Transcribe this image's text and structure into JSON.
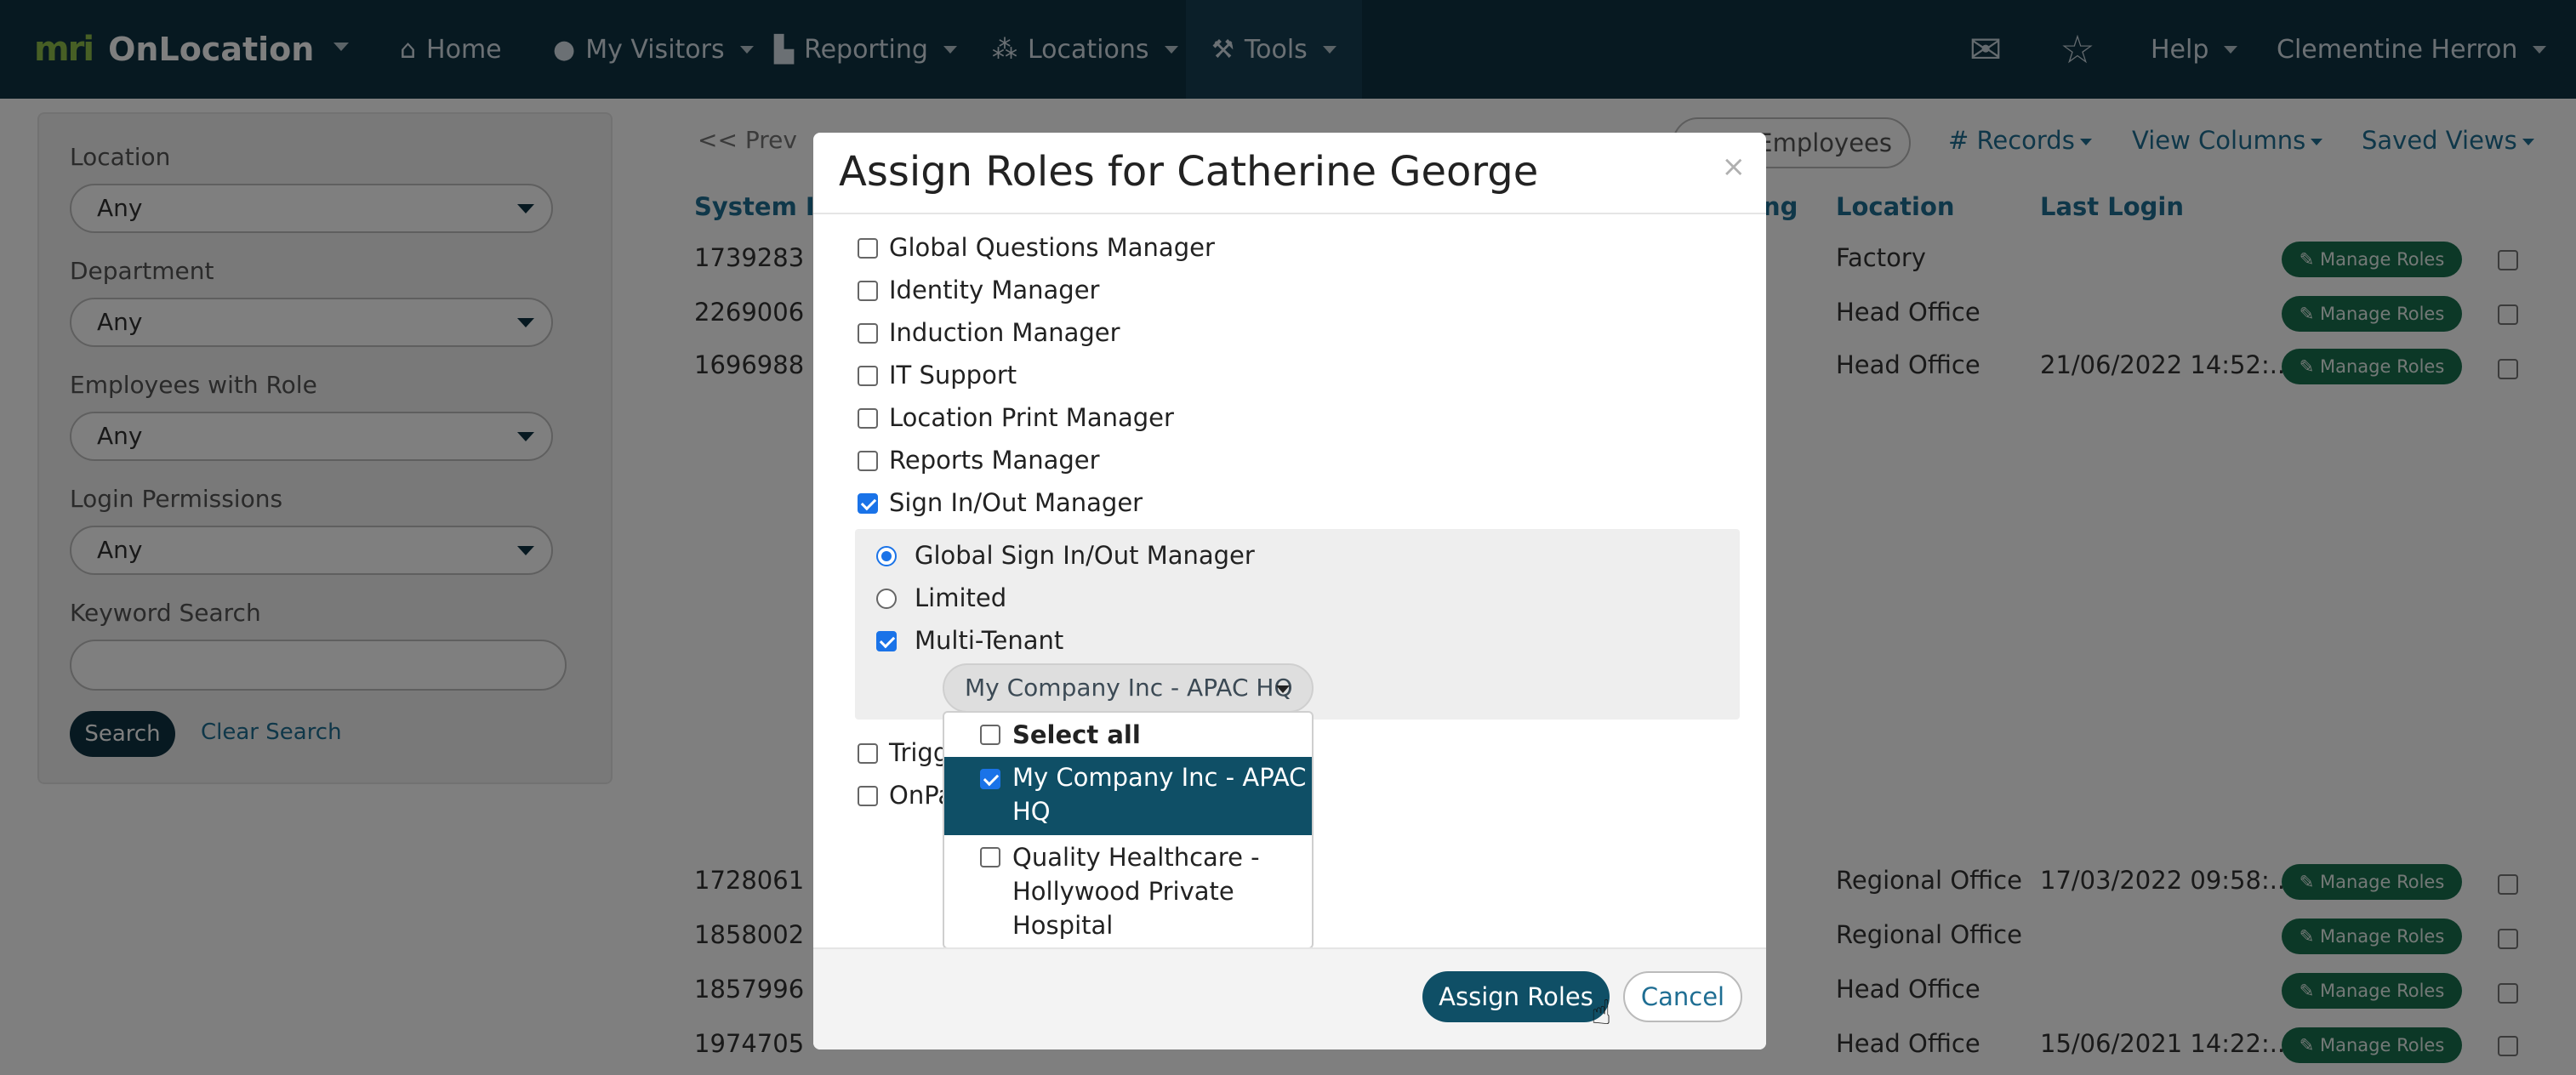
{
  "navbar": {
    "logo_mark": "mri",
    "app_name": "OnLocation",
    "items": [
      {
        "label": "Home",
        "icon": "home-icon"
      },
      {
        "label": "My Visitors",
        "icon": "person-icon"
      },
      {
        "label": "Reporting",
        "icon": "bar-chart-icon"
      },
      {
        "label": "Locations",
        "icon": "network-icon"
      },
      {
        "label": "Tools",
        "icon": "wrench-icon"
      }
    ],
    "help": "Help",
    "user": "Clementine Herron"
  },
  "filters": {
    "location_label": "Location",
    "location_value": "Any",
    "department_label": "Department",
    "department_value": "Any",
    "role_label": "Employees with Role",
    "role_value": "Any",
    "login_label": "Login Permissions",
    "login_value": "Any",
    "keyword_label": "Keyword Search",
    "keyword_value": "",
    "search_button": "Search",
    "clear_link": "Clear Search"
  },
  "toolbar": {
    "prev": "<< Prev",
    "employees": "Employees",
    "records": "# Records",
    "view_columns": "View Columns",
    "saved_views": "Saved Views"
  },
  "table": {
    "headers": {
      "system_id": "System ID",
      "ng": "ng",
      "location": "Location",
      "last_login": "Last Login"
    },
    "manage_label": "Manage Roles",
    "rows": [
      {
        "id": "1739283",
        "location": "Factory",
        "last_login": ""
      },
      {
        "id": "2269006",
        "location": "Head Office",
        "last_login": ""
      },
      {
        "id": "1696988",
        "location": "Head Office",
        "last_login": "21/06/2022 14:52:..."
      },
      {
        "id": "1728061",
        "location": "Regional Office",
        "last_login": "17/03/2022 09:58:..."
      },
      {
        "id": "1858002",
        "location": "Regional Office",
        "last_login": ""
      },
      {
        "id": "1857996",
        "location": "Head Office",
        "last_login": ""
      },
      {
        "id": "1974705",
        "location": "Head Office",
        "last_login": "15/06/2021 14:22:..."
      }
    ]
  },
  "modal": {
    "title": "Assign Roles for Catherine George",
    "close": "×",
    "roles": [
      {
        "label": "Global Questions Manager",
        "checked": false
      },
      {
        "label": "Identity Manager",
        "checked": false
      },
      {
        "label": "Induction Manager",
        "checked": false
      },
      {
        "label": "IT Support",
        "checked": false
      },
      {
        "label": "Location Print Manager",
        "checked": false
      },
      {
        "label": "Reports Manager",
        "checked": false
      },
      {
        "label": "Sign In/Out Manager",
        "checked": true
      }
    ],
    "sign_in_out": {
      "global": "Global Sign In/Out Manager",
      "limited": "Limited",
      "multi_tenant": "Multi-Tenant",
      "tenant_selected": "My Company Inc - APAC HQ"
    },
    "roles_after": [
      {
        "label": "Trigg",
        "checked": false
      },
      {
        "label": "OnPa",
        "checked": false
      }
    ],
    "tenant_dropdown": {
      "select_all": "Select all",
      "option_1_line_1": "My Company Inc - APAC",
      "option_1_line_2": "HQ",
      "option_2_line_1": "Quality Healthcare -",
      "option_2_line_2": "Hollywood Private",
      "option_2_line_3": "Hospital"
    },
    "assign_button": "Assign Roles",
    "cancel_button": "Cancel"
  }
}
